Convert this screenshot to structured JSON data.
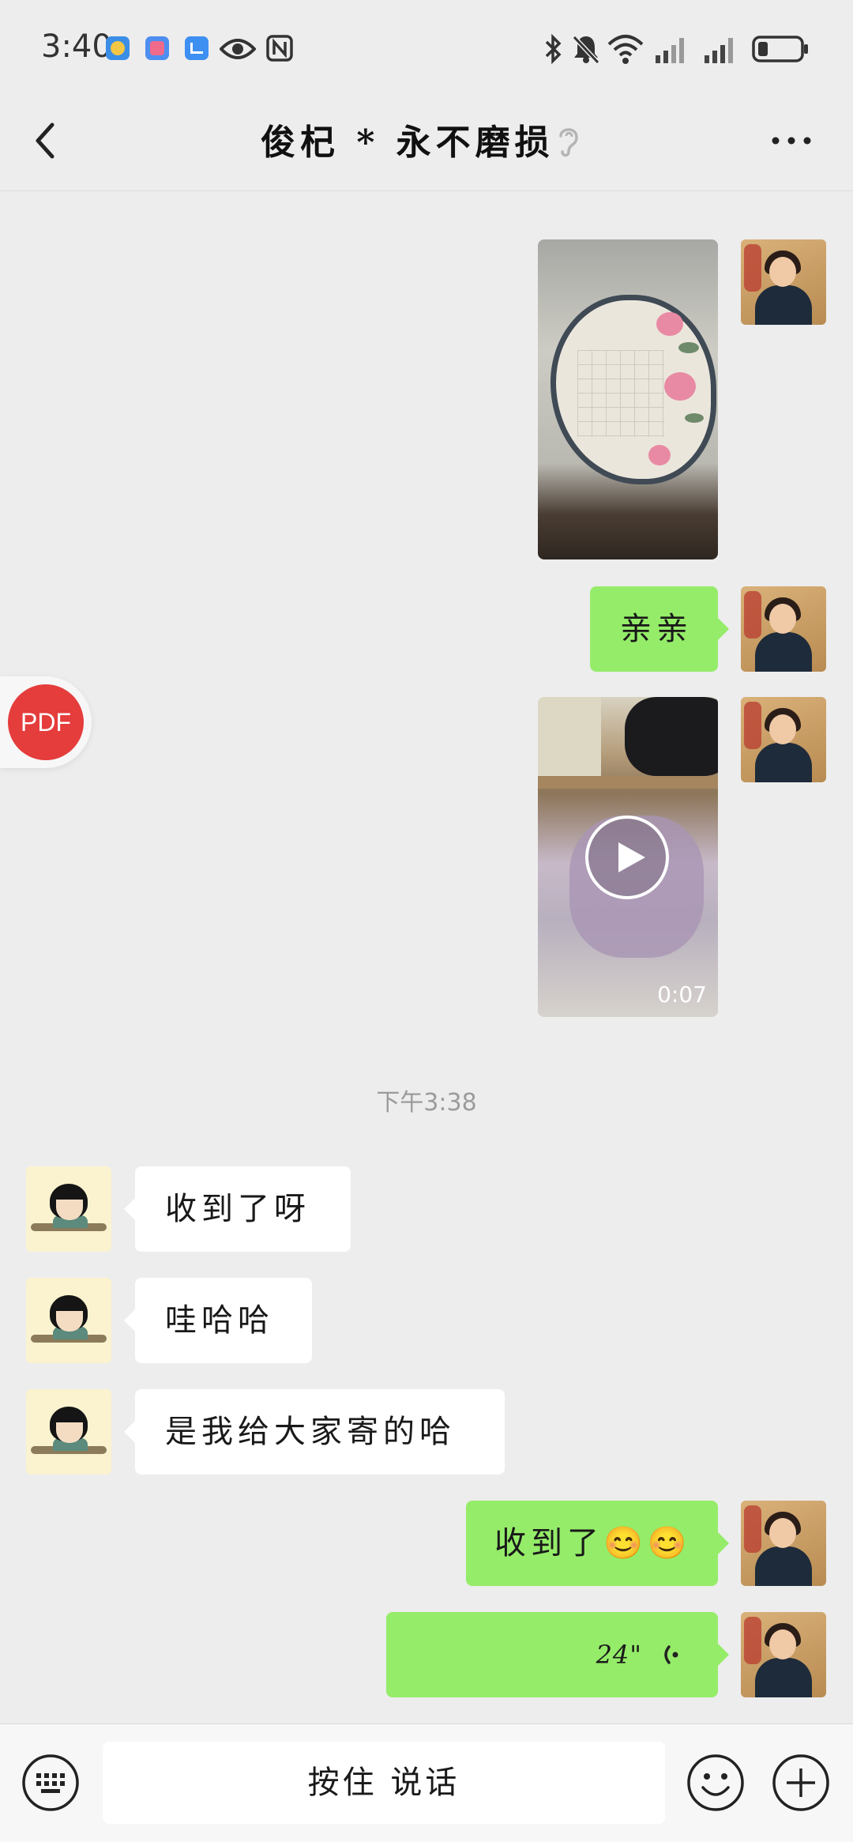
{
  "status_bar": {
    "time": "3:40",
    "icons": [
      "app-icon-orange",
      "app-icon-pink",
      "app-icon-blue",
      "eye-icon",
      "nfc-icon",
      "bluetooth-icon",
      "mute-icon",
      "wifi-icon",
      "signal-icon",
      "signal-icon",
      "battery-icon"
    ]
  },
  "header": {
    "title": "俊杞 * 永不磨损",
    "back_icon": "chevron-left-icon",
    "ear_icon": "ear-icon",
    "more_icon": "more-dots-icon"
  },
  "messages": {
    "m2_text": "亲亲",
    "video_duration": "0:07",
    "time_stamp": "下午3:38",
    "m4_text": "收到了呀",
    "m5_text": "哇哈哈",
    "m6_text": "是我给大家寄的哈",
    "m7_text": "收到了😊😊",
    "m8_voice_duration": "24\""
  },
  "floating": {
    "pdf_label": "PDF"
  },
  "input_bar": {
    "hold_to_talk": "按住 说话",
    "left_icon": "keyboard-icon",
    "emoji_icon": "emoji-icon",
    "plus_icon": "plus-icon"
  },
  "colors": {
    "background": "#ededed",
    "my_bubble": "#95ec69",
    "friend_bubble": "#ffffff",
    "pdf_badge": "#e53c3c"
  }
}
